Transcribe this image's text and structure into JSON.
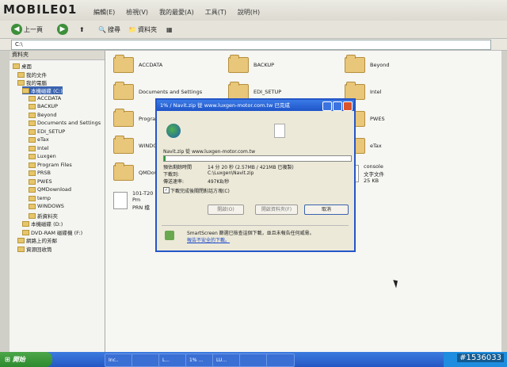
{
  "brand": {
    "logo": "MOBILE01"
  },
  "menu": [
    "編輯(E)",
    "檢視(V)",
    "我的最愛(A)",
    "工具(T)",
    "說明(H)"
  ],
  "toolbar": {
    "back": "上一頁",
    "search": "搜尋",
    "folders": "資料夾"
  },
  "address": {
    "value": "C:\\"
  },
  "tree": {
    "header": "資料夾",
    "items": [
      "桌面",
      "我的文件",
      "我的電腦",
      "本機磁碟 (C:)",
      "ACCDATA",
      "BACKUP",
      "Beyond",
      "Documents and Settings",
      "EDI_SETUP",
      "eTax",
      "Intel",
      "Luxgen",
      "Program Files",
      "PRSB",
      "PWES",
      "QMDownload",
      "temp",
      "WINDOWS",
      "新資料夾",
      "本機磁碟 (D:)",
      "DVD-RAM 磁碟機 (F:)",
      "網路上的芳鄰",
      "資源回收筒"
    ]
  },
  "files": {
    "items": [
      "ACCDATA",
      "BACKUP",
      "Beyond",
      "Documents and Settings",
      "EDI_SETUP",
      "Intel",
      "Program",
      "PWES",
      "WINDO",
      "eTax",
      "QMDow",
      "console"
    ],
    "console_desc": "文字文件",
    "console_size": "25 KB",
    "doc_name": "101-T20",
    "doc_line2": "Pm",
    "doc_line3": "PRN 檔"
  },
  "dialog": {
    "title": "1% / Navit.zip 從 www.luxgen-motor.com.tw 已完成",
    "source": "Navit.zip 從 www.luxgen-motor.com.tw",
    "progress_pct": 1,
    "rows": [
      {
        "label": "預估剩餘時間",
        "value": "14 分 20 秒 (2.57MB / 421MB 已複製)"
      },
      {
        "label": "下載到:",
        "value": "C:\\Luxgen\\Navit.zip"
      },
      {
        "label": "傳送速率:",
        "value": "497KB/秒"
      }
    ],
    "checkbox": "下載完成後關閉對話方塊(C)",
    "buttons": [
      "開啟(O)",
      "開啟資料夾(F)",
      "取消"
    ],
    "footer_line1": "SmartScreen 篩選已檢查這個下載，並且未報告任何威脅。",
    "footer_link": "報告不安全的下載。"
  },
  "taskbar": {
    "start": "開始",
    "tasks": [
      "Inc..",
      "",
      "L...",
      "1% ...",
      "LU...",
      "",
      ""
    ]
  },
  "watermark": "#1536033"
}
